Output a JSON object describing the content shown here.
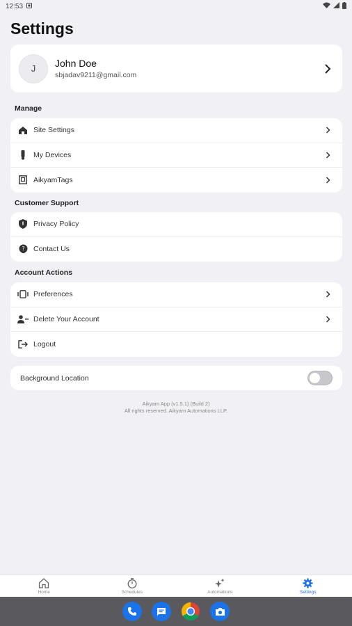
{
  "status_bar": {
    "time": "12:53"
  },
  "page": {
    "title": "Settings"
  },
  "profile": {
    "initial": "J",
    "name": "John Doe",
    "email": "sbjadav9211@gmail.com"
  },
  "sections": {
    "manage": {
      "title": "Manage",
      "items": [
        {
          "label": "Site Settings",
          "icon": "home-icon"
        },
        {
          "label": "My Devices",
          "icon": "device-icon"
        },
        {
          "label": "AikyamTags",
          "icon": "tag-icon"
        }
      ]
    },
    "support": {
      "title": "Customer Support",
      "items": [
        {
          "label": "Privacy Policy",
          "icon": "shield-icon"
        },
        {
          "label": "Contact Us",
          "icon": "help-icon"
        }
      ]
    },
    "account": {
      "title": "Account Actions",
      "items": [
        {
          "label": "Preferences",
          "icon": "preferences-icon"
        },
        {
          "label": "Delete Your Account",
          "icon": "person-remove-icon"
        },
        {
          "label": "Logout",
          "icon": "logout-icon"
        }
      ]
    }
  },
  "background_location": {
    "label": "Background Location",
    "enabled": false
  },
  "footer": {
    "version": "Aikyam App (v1.5.1) (Build 2)",
    "rights": "All rights reserved. Aikyam Automations LLP."
  },
  "bottom_nav": {
    "items": [
      {
        "label": "Home",
        "icon": "home-icon"
      },
      {
        "label": "Schedules",
        "icon": "timer-icon"
      },
      {
        "label": "Automations",
        "icon": "sparkle-icon"
      },
      {
        "label": "Settings",
        "icon": "gear-icon",
        "active": true
      }
    ]
  },
  "colors": {
    "accent": "#1f6fe5",
    "background": "#f1f1f5",
    "card": "#ffffff"
  }
}
